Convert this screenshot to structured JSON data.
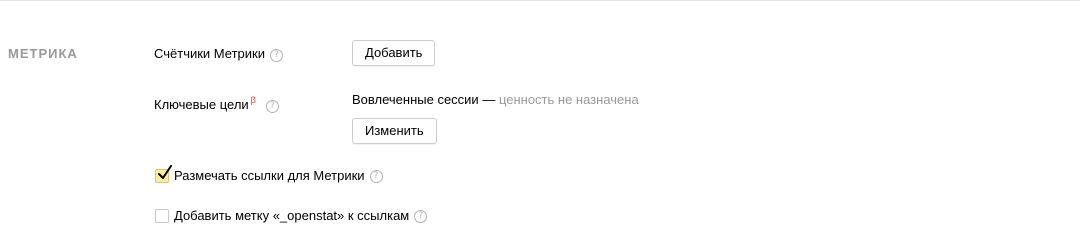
{
  "section": {
    "title": "Метрика"
  },
  "counters": {
    "label": "Счётчики Метрики",
    "add_button": "Добавить"
  },
  "key_goals": {
    "label": "Ключевые цели",
    "beta": "β",
    "goal_name": "Вовлеченные сессии",
    "dash": " — ",
    "goal_status": "ценность не назначена",
    "change_button": "Изменить"
  },
  "checkboxes": [
    {
      "label": "Размечать ссылки для Метрики",
      "checked": true
    },
    {
      "label": "Добавить метку «_openstat» к ссылкам",
      "checked": false
    }
  ],
  "help_glyph": "?",
  "colors": {
    "section_title": "#999999",
    "beta": "#ff3333",
    "muted_text": "#999999",
    "checkbox_checked_bg": "#ffeba0"
  }
}
